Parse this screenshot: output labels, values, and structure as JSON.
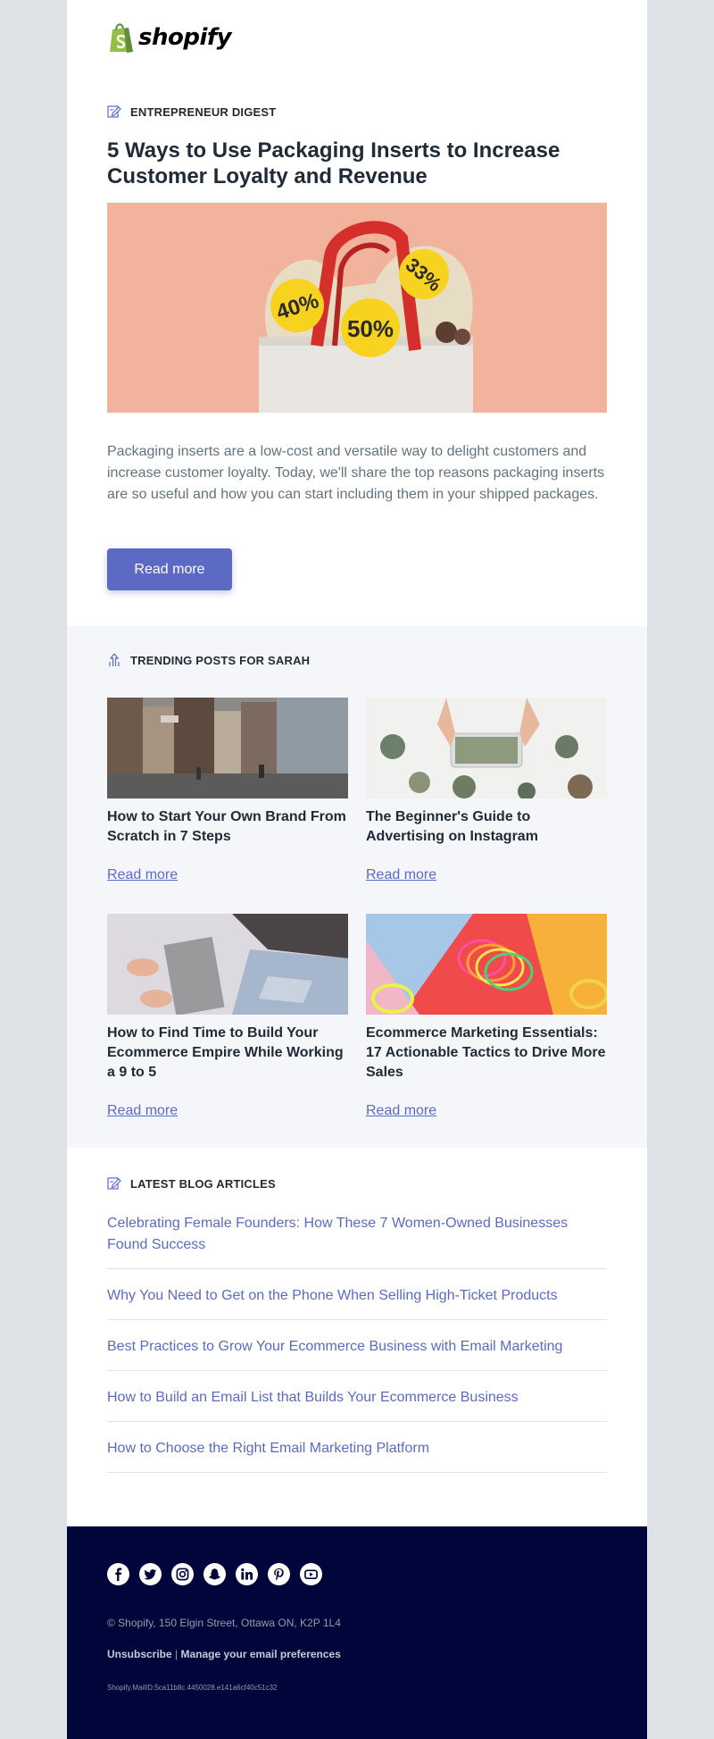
{
  "brand": {
    "name": "shopify",
    "accent": "#5c6ac4",
    "green": "#95bf47",
    "footer_bg": "#000639"
  },
  "hero": {
    "section_title": "ENTREPRENEUR DIGEST",
    "title": "5 Ways to Use Packaging Inserts to Increase Customer Loyalty and Revenue",
    "image_tags": [
      "40%",
      "50%",
      "33%"
    ],
    "body": "Packaging inserts are a low-cost and versatile way to delight customers and increase customer loyalty. Today, we'll share the top reasons packaging inserts are so useful and how you can start including them in your shipped packages.",
    "button_label": "Read more"
  },
  "trending": {
    "section_title": "TRENDING POSTS FOR SARAH",
    "posts": [
      {
        "title": "How to Start Your Own Brand From Scratch in 7 Steps",
        "link": "Read more"
      },
      {
        "title": "The Beginner's Guide to Advertising on Instagram",
        "link": "Read more"
      },
      {
        "title": "How to Find Time to Build Your Ecommerce Empire While Working a 9 to 5",
        "link": "Read more"
      },
      {
        "title": "Ecommerce Marketing Essentials: 17 Actionable Tactics to Drive More Sales",
        "link": "Read more"
      }
    ]
  },
  "latest": {
    "section_title": "LATEST BLOG ARTICLES",
    "articles": [
      "Celebrating Female Founders: How These 7 Women-Owned Businesses Found Success",
      "Why You Need to Get on the Phone When Selling High-Ticket Products",
      "Best Practices to Grow Your Ecommerce Business with Email Marketing",
      "How to Build an Email List that Builds Your Ecommerce Business",
      "How to Choose the Right Email Marketing Platform"
    ]
  },
  "footer": {
    "socials": [
      "facebook-icon",
      "twitter-icon",
      "instagram-icon",
      "snapchat-icon",
      "linkedin-icon",
      "pinterest-icon",
      "youtube-icon"
    ],
    "address": "© Shopify,  150 Elgin Street, Ottawa ON, K2P 1L4",
    "unsubscribe": "Unsubscribe",
    "separator": "|",
    "preferences": "Manage your email preferences",
    "mail_id": "Shopify.MailID:5ca11b8c.4450028.e141a6cf40c51c32"
  }
}
